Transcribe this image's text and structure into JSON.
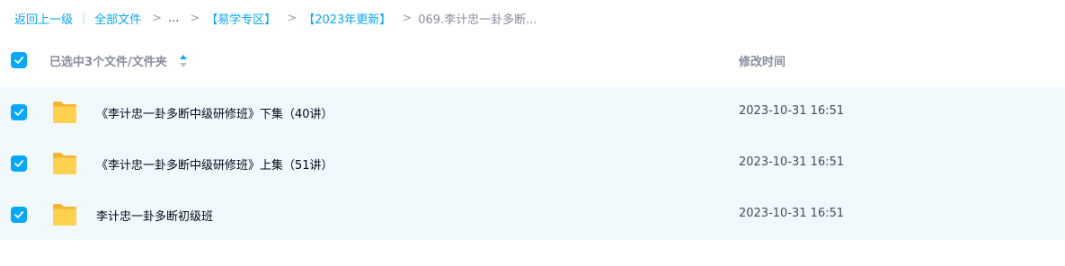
{
  "breadcrumb": {
    "back_label": "返回上一级",
    "root_label": "全部文件",
    "ellipsis": "...",
    "level1": "【易学专区】",
    "level2": "【2023年更新】",
    "current": "069.李计忠一卦多断..."
  },
  "header": {
    "selection_label": "已选中3个文件/文件夹",
    "time_label": "修改时间",
    "all_checked": true
  },
  "files": [
    {
      "name": "《李计忠一卦多断中级研修班》下集（40讲）",
      "modified": "2023-10-31 16:51",
      "checked": true,
      "icon": "folder-icon"
    },
    {
      "name": "《李计忠一卦多断中级研修班》上集（51讲）",
      "modified": "2023-10-31 16:51",
      "checked": true,
      "icon": "folder-icon"
    },
    {
      "name": "李计忠一卦多断初级班",
      "modified": "2023-10-31 16:51",
      "checked": true,
      "icon": "folder-icon"
    }
  ],
  "colors": {
    "accent": "#06a7ff",
    "row_selected_bg": "#f1f9fd",
    "folder": "#ffc73d"
  }
}
